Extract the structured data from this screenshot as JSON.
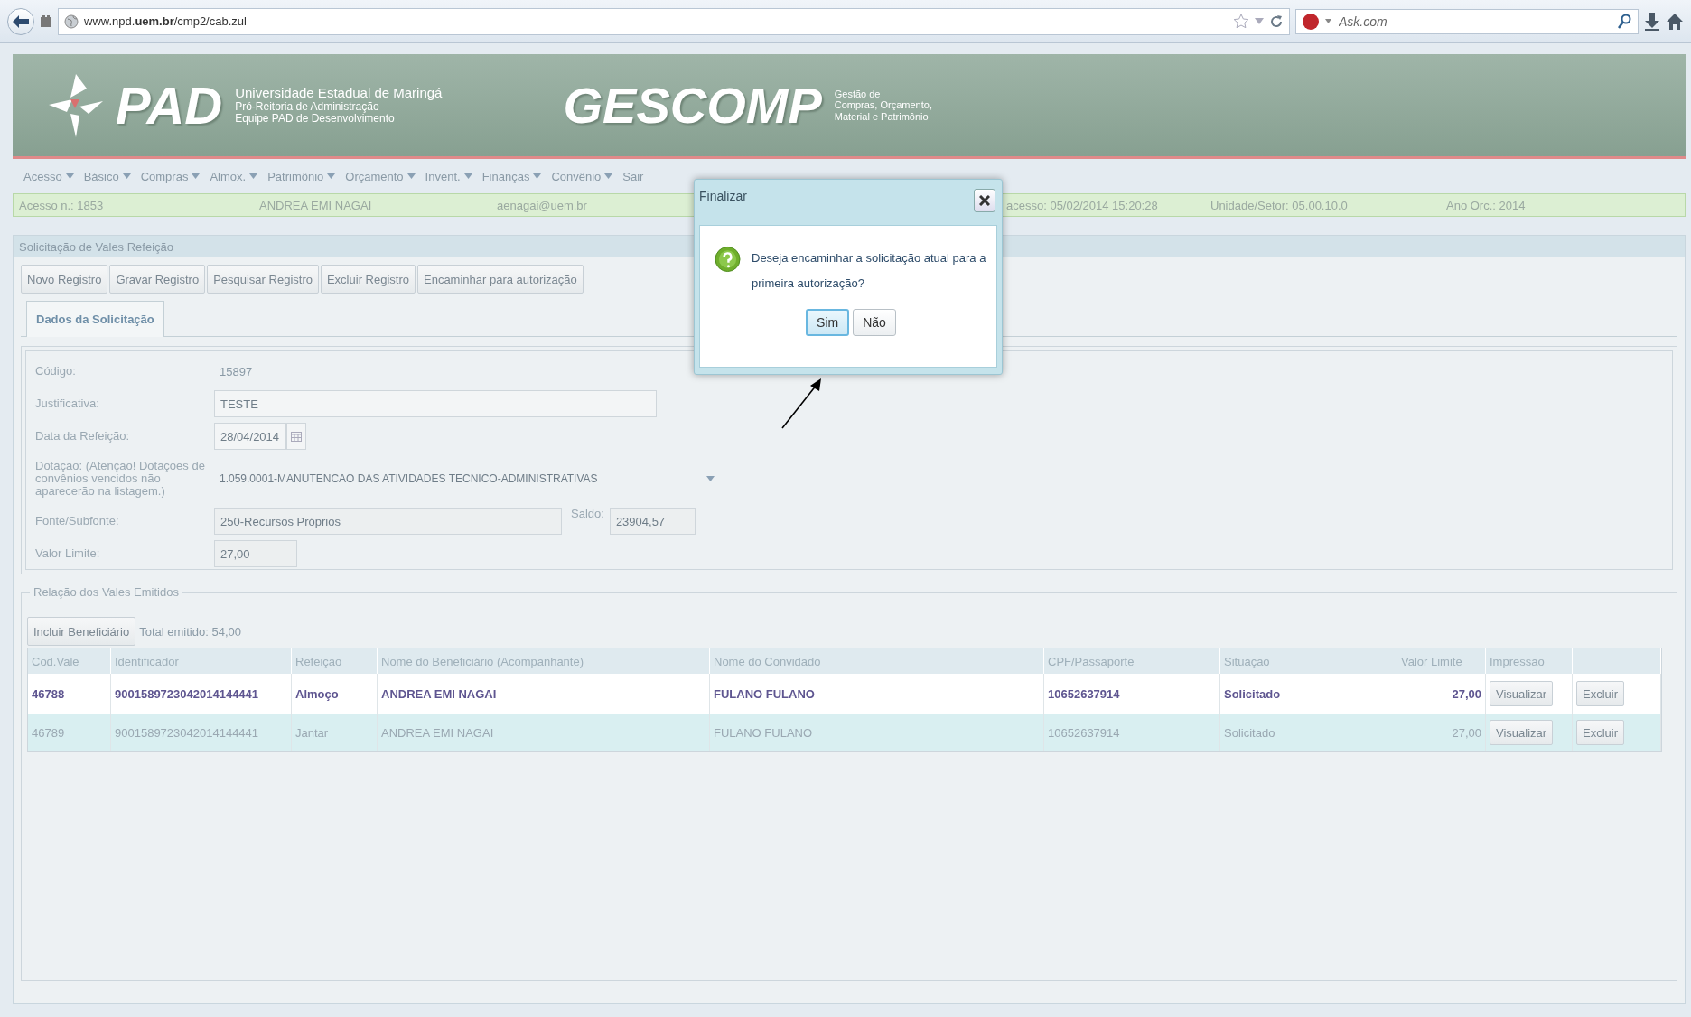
{
  "browser": {
    "url": "www.npd.**uem.br**/cmp2/cab.zul",
    "search": {
      "placeholder": "Ask.com"
    }
  },
  "header": {
    "logo": "PAD",
    "org_lines": [
      "Universidade Estadual de Maringá",
      "Pró-Reitoria de Administração",
      "Equipe PAD de Desenvolvimento"
    ],
    "system": "GESCOMP",
    "system_lines": [
      "Gestão de",
      "Compras, Orçamento,",
      "Material e Patrimônio"
    ]
  },
  "menu": [
    {
      "label": "Acesso",
      "dropdown": true
    },
    {
      "label": "Básico",
      "dropdown": true
    },
    {
      "label": "Compras",
      "dropdown": true
    },
    {
      "label": "Almox.",
      "dropdown": true
    },
    {
      "label": "Patrimônio",
      "dropdown": true
    },
    {
      "label": "Orçamento",
      "dropdown": true
    },
    {
      "label": "Invent.",
      "dropdown": true
    },
    {
      "label": "Finanças",
      "dropdown": true
    },
    {
      "label": "Convênio",
      "dropdown": true
    },
    {
      "label": "Sair",
      "dropdown": false
    }
  ],
  "info_bar": [
    "Acesso n.: 1853",
    "ANDREA EMI NAGAI",
    "aenagai@uem.br",
    "acesso: 05/02/2014 15:20:28",
    "Unidade/Setor: 05.00.10.0",
    "Ano Orc.: 2014"
  ],
  "panel": {
    "title": "Solicitação de Vales Refeição",
    "toolbar": [
      "Novo Registro",
      "Gravar Registro",
      "Pesquisar Registro",
      "Excluir Registro",
      "Encaminhar para autorização"
    ],
    "tabs": [
      {
        "label": "Dados da Solicitação",
        "selected": true
      }
    ],
    "form": [
      {
        "label": "Código:",
        "kind": "text",
        "value": "15897"
      },
      {
        "label": "Justificativa:",
        "kind": "input",
        "value": "TESTE"
      },
      {
        "label": "Data da Refeição:",
        "kind": "date",
        "value": "28/04/2014"
      },
      {
        "label": "Dotação: (Atenção! Dotações de convênios vencidos não aparecerão na listagem.)",
        "kind": "select",
        "value": "1.059.0001-MANUTENCAO DAS ATIVIDADES TECNICO-ADMINISTRATIVAS"
      },
      {
        "label": "Fonte/Subfonte:",
        "kind": "readonly",
        "value": "250-Recursos Próprios",
        "extra_label": "Saldo:",
        "extra_value": "23904,57"
      },
      {
        "label": "Valor Limite:",
        "kind": "short",
        "value": "27,00"
      }
    ]
  },
  "vales": {
    "legend": "Relação dos Vales Emitidos",
    "add_button": "Incluir Beneficiário",
    "total": "Total emitido: 54,00",
    "columns": [
      "Cod.Vale",
      "Identificador",
      "Refeição",
      "Nome do Beneficiário (Acompanhante)",
      "Nome do Convidado",
      "CPF/Passaporte",
      "Situação",
      "Valor Limite",
      "Impressão"
    ],
    "rows": [
      {
        "selected": true,
        "cells": [
          "46788",
          "9001589723042014144441",
          "Almoço",
          "ANDREA EMI NAGAI",
          "FULANO FULANO",
          "10652637914",
          "Solicitado",
          "27,00"
        ],
        "view_button": "Visualizar",
        "delete_button": "Excluir"
      },
      {
        "selected": false,
        "cells": [
          "46789",
          "9001589723042014144441",
          "Jantar",
          "ANDREA EMI NAGAI",
          "FULANO FULANO",
          "10652637914",
          "Solicitado",
          "27,00"
        ],
        "view_button": "Visualizar",
        "delete_button": "Excluir"
      }
    ]
  },
  "dialog": {
    "title": "Finalizar",
    "message": "Deseja encaminhar a solicitação atual para a primeira autorização?",
    "buttons": [
      {
        "label": "Sim",
        "focused": true
      },
      {
        "label": "Não",
        "focused": false
      }
    ]
  }
}
